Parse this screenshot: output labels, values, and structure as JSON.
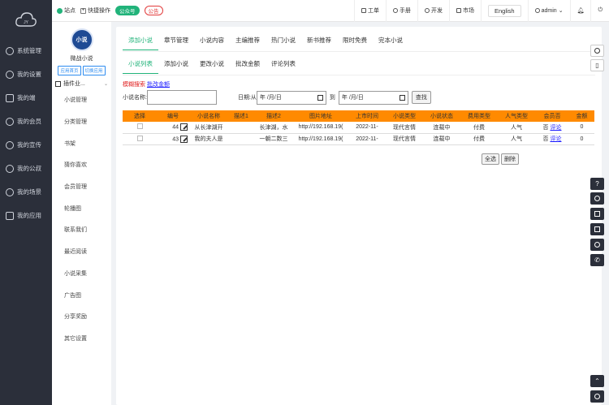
{
  "brand": {
    "logo_text": "JY"
  },
  "main_nav": [
    {
      "label": "系统管理",
      "icon": "gear-icon"
    },
    {
      "label": "我的设置",
      "icon": "settings-icon"
    },
    {
      "label": "我的端",
      "icon": "grid-icon"
    },
    {
      "label": "我的会员",
      "icon": "user-icon"
    },
    {
      "label": "我的宣传",
      "icon": "megaphone-icon"
    },
    {
      "label": "我的公叔",
      "icon": "chat-icon"
    },
    {
      "label": "我的场景",
      "icon": "scene-icon"
    },
    {
      "label": "我的应用",
      "icon": "apps-icon"
    }
  ],
  "topbar": {
    "site_label": "站点",
    "quick_label": "快捷操作",
    "badge_public": "公众号",
    "badge_notice": "公告",
    "right_items": [
      "工单",
      "手册",
      "开发",
      "市场"
    ],
    "language": "English",
    "user": "admin"
  },
  "app": {
    "avatar_text": "小说",
    "name": "微战小说",
    "btn_home": "应用首页",
    "btn_switch": "切换应用",
    "plugin_label": "插件业..."
  },
  "sub_nav": [
    "小说管理",
    "分类管理",
    "书架",
    "猜你喜欢",
    "会员管理",
    "轮播图",
    "联系我们",
    "最近阅读",
    "小说采集",
    "广告图",
    "分享奖励",
    "其它设置"
  ],
  "tabs_primary": [
    "添加小说",
    "章节管理",
    "小说内容",
    "主编推荐",
    "热门小说",
    "新书推荐",
    "限时免费",
    "完本小说"
  ],
  "tabs_secondary": [
    "小说列表",
    "添加小说",
    "更改小说",
    "批改金额",
    "评论列表"
  ],
  "search": {
    "fuzzy_label": "模糊搜索",
    "batch_link": "批改金额",
    "name_label": "小说名称:",
    "date_label": "日期:从",
    "to_label": "到",
    "date_placeholder": "年 /月/日",
    "button": "查找"
  },
  "table": {
    "columns": [
      "选择",
      "编号",
      "小说名称",
      "描述1",
      "描述2",
      "图片地址",
      "上市时间",
      "小说类型",
      "小说状态",
      "费用类型",
      "人气类型",
      "会员否",
      "金额"
    ],
    "rows": [
      {
        "id": "44",
        "name": "从长津湖开",
        "desc1": "",
        "desc2": "长津湖，水",
        "img": "http://192.168.19(",
        "date": "2022-11-",
        "type": "现代言情",
        "status": "连载中",
        "fee": "付费",
        "pop": "人气",
        "vip": "否",
        "comment": "评论",
        "amount": "0"
      },
      {
        "id": "43",
        "name": "我的夫人是",
        "desc1": "",
        "desc2": "一朝二数三",
        "img": "http://192.168.19(",
        "date": "2022-11-",
        "type": "现代言情",
        "status": "连载中",
        "fee": "付费",
        "pop": "人气",
        "vip": "否",
        "comment": "评论",
        "amount": "0"
      }
    ]
  },
  "bottom": {
    "select_all": "全选",
    "delete": "删除"
  },
  "colors": {
    "accent": "#21b37a",
    "header_orange": "#ff8a00",
    "sidebar_dark": "#2b2f3a"
  }
}
